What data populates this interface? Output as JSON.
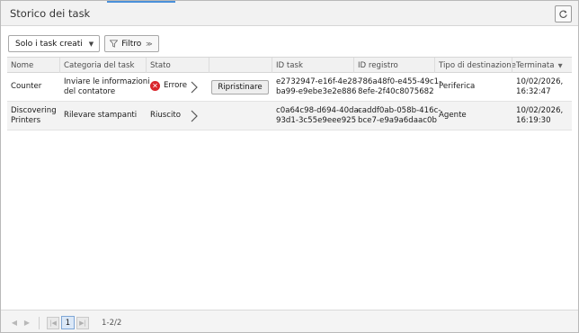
{
  "window": {
    "title": "Storico dei task"
  },
  "toolbar": {
    "scope_select": "Solo i task creati",
    "filter_label": "Filtro"
  },
  "columns": {
    "name": "Nome",
    "category": "Categoria del task",
    "status": "Stato",
    "task_id": "ID task",
    "log_id": "ID registro",
    "destination": "Tipo di destinazione",
    "completed": "Terminata"
  },
  "rows": [
    {
      "name_l1": "Counter",
      "name_l2": "",
      "category_l1": "Inviare le informazioni",
      "category_l2": "del contatore",
      "status": "Errore",
      "action": "Ripristinare",
      "task_id_l1": "e2732947-e16f-4e28-",
      "task_id_l2": "ba99-e9ebe3e2e886",
      "log_id_l1": "786a48f0-e455-49c1-",
      "log_id_l2": "8efe-2f40c8075682",
      "destination": "Periferica",
      "completed_l1": "10/02/2026,",
      "completed_l2": "16:32:47"
    },
    {
      "name_l1": "Discovering",
      "name_l2": "Printers",
      "category_l1": "Rilevare stampanti",
      "category_l2": "",
      "status": "Riuscito",
      "action": "",
      "task_id_l1": "c0a64c98-d694-40da-",
      "task_id_l2": "93d1-3c55e9eee925",
      "log_id_l1": "caddf0ab-058b-416c-",
      "log_id_l2": "bce7-e9a9a6daac0b",
      "destination": "Agente",
      "completed_l1": "10/02/2026,",
      "completed_l2": "16:19:30"
    }
  ],
  "pager": {
    "current_page": "1",
    "range": "1-2/2"
  }
}
